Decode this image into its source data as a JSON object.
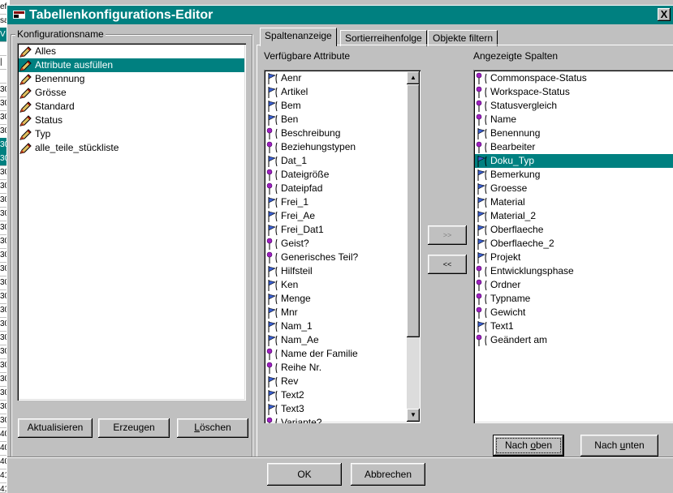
{
  "background_column": {
    "cells": [
      {
        "text": "ef",
        "hl": false
      },
      {
        "text": "sa",
        "hl": false
      },
      {
        "text": "V",
        "hl": true
      },
      {
        "text": "",
        "hl": false
      },
      {
        "text": "|",
        "hl": false
      },
      {
        "text": "",
        "hl": false
      },
      {
        "text": "30",
        "hl": false
      },
      {
        "text": "30",
        "hl": false
      },
      {
        "text": "30",
        "hl": false
      },
      {
        "text": "30",
        "hl": false
      },
      {
        "text": "30",
        "hl": true
      },
      {
        "text": "30",
        "hl": true
      },
      {
        "text": "30",
        "hl": false
      },
      {
        "text": "30",
        "hl": false
      },
      {
        "text": "30",
        "hl": false
      },
      {
        "text": "30",
        "hl": false
      },
      {
        "text": "30",
        "hl": false
      },
      {
        "text": "30",
        "hl": false
      },
      {
        "text": "30",
        "hl": false
      },
      {
        "text": "30",
        "hl": false
      },
      {
        "text": "30",
        "hl": false
      },
      {
        "text": "30",
        "hl": false
      },
      {
        "text": "30",
        "hl": false
      },
      {
        "text": "30",
        "hl": false
      },
      {
        "text": "30",
        "hl": false
      },
      {
        "text": "30",
        "hl": false
      },
      {
        "text": "30",
        "hl": false
      },
      {
        "text": "30",
        "hl": false
      },
      {
        "text": "30",
        "hl": false
      },
      {
        "text": "30",
        "hl": false
      },
      {
        "text": "30",
        "hl": false
      },
      {
        "text": "40",
        "hl": false
      },
      {
        "text": "40",
        "hl": false
      },
      {
        "text": "40",
        "hl": false
      },
      {
        "text": "41",
        "hl": false
      },
      {
        "text": "41",
        "hl": false
      }
    ]
  },
  "window": {
    "title": "Tabellenkonfigurations-Editor",
    "close_glyph": "X"
  },
  "config_group": {
    "legend": "Konfigurationsname",
    "items": [
      {
        "label": "Alles",
        "selected": false
      },
      {
        "label": "Attribute ausfüllen",
        "selected": true
      },
      {
        "label": "Benennung",
        "selected": false
      },
      {
        "label": "Grösse",
        "selected": false
      },
      {
        "label": "Standard",
        "selected": false
      },
      {
        "label": "Status",
        "selected": false
      },
      {
        "label": "Typ",
        "selected": false
      },
      {
        "label": "alle_teile_stückliste",
        "selected": false
      }
    ],
    "buttons": {
      "refresh": "Aktualisieren",
      "create": "Erzeugen",
      "delete_underlined": "L",
      "delete_rest": "öschen"
    }
  },
  "tabs": [
    {
      "label": "Spaltenanzeige",
      "active": true
    },
    {
      "label": "Sortierreihenfolge",
      "active": false
    },
    {
      "label": "Objekte filtern",
      "active": false
    }
  ],
  "available": {
    "label": "Verfügbare Attribute",
    "items": [
      {
        "label": "Aenr",
        "icon": "flag"
      },
      {
        "label": "Artikel",
        "icon": "flag"
      },
      {
        "label": "Bem",
        "icon": "flag"
      },
      {
        "label": "Ben",
        "icon": "flag"
      },
      {
        "label": "Beschreibung",
        "icon": "pin"
      },
      {
        "label": "Beziehungstypen",
        "icon": "pin"
      },
      {
        "label": "Dat_1",
        "icon": "flag"
      },
      {
        "label": "Dateigröße",
        "icon": "pin"
      },
      {
        "label": "Dateipfad",
        "icon": "pin"
      },
      {
        "label": "Frei_1",
        "icon": "flag"
      },
      {
        "label": "Frei_Ae",
        "icon": "flag"
      },
      {
        "label": "Frei_Dat1",
        "icon": "flag"
      },
      {
        "label": "Geist?",
        "icon": "pin"
      },
      {
        "label": "Generisches Teil?",
        "icon": "pin"
      },
      {
        "label": "Hilfsteil",
        "icon": "flag"
      },
      {
        "label": "Ken",
        "icon": "flag"
      },
      {
        "label": "Menge",
        "icon": "flag"
      },
      {
        "label": "Mnr",
        "icon": "flag"
      },
      {
        "label": "Nam_1",
        "icon": "flag"
      },
      {
        "label": "Nam_Ae",
        "icon": "flag"
      },
      {
        "label": "Name der Familie",
        "icon": "pin"
      },
      {
        "label": "Reihe Nr.",
        "icon": "pin"
      },
      {
        "label": "Rev",
        "icon": "flag"
      },
      {
        "label": "Text2",
        "icon": "flag"
      },
      {
        "label": "Text3",
        "icon": "flag"
      },
      {
        "label": "Variante?",
        "icon": "pin"
      }
    ]
  },
  "move_buttons": {
    "add": ">>",
    "remove": "<<"
  },
  "displayed": {
    "label": "Angezeigte Spalten",
    "items": [
      {
        "label": "Commonspace-Status",
        "icon": "pin",
        "selected": false
      },
      {
        "label": "Workspace-Status",
        "icon": "pin",
        "selected": false
      },
      {
        "label": "Statusvergleich",
        "icon": "pin",
        "selected": false
      },
      {
        "label": "Name",
        "icon": "pin",
        "selected": false
      },
      {
        "label": "Benennung",
        "icon": "flag",
        "selected": false
      },
      {
        "label": "Bearbeiter",
        "icon": "pin",
        "selected": false
      },
      {
        "label": "Doku_Typ",
        "icon": "flag",
        "selected": true
      },
      {
        "label": "Bemerkung",
        "icon": "flag",
        "selected": false
      },
      {
        "label": "Groesse",
        "icon": "flag",
        "selected": false
      },
      {
        "label": "Material",
        "icon": "flag",
        "selected": false
      },
      {
        "label": "Material_2",
        "icon": "flag",
        "selected": false
      },
      {
        "label": "Oberflaeche",
        "icon": "flag",
        "selected": false
      },
      {
        "label": "Oberflaeche_2",
        "icon": "flag",
        "selected": false
      },
      {
        "label": "Projekt",
        "icon": "flag",
        "selected": false
      },
      {
        "label": "Entwicklungsphase",
        "icon": "pin",
        "selected": false
      },
      {
        "label": "Ordner",
        "icon": "pin",
        "selected": false
      },
      {
        "label": "Typname",
        "icon": "pin",
        "selected": false
      },
      {
        "label": "Gewicht",
        "icon": "pin",
        "selected": false
      },
      {
        "label": "Text1",
        "icon": "flag",
        "selected": false
      },
      {
        "label": "Geändert am",
        "icon": "pin",
        "selected": false
      }
    ]
  },
  "order_buttons": {
    "up_pre": "Nach ",
    "up_ul": "o",
    "up_post": "ben",
    "down_pre": "Nach ",
    "down_ul": "u",
    "down_post": "nten"
  },
  "dialog_buttons": {
    "ok": "OK",
    "cancel": "Abbrechen"
  },
  "colors": {
    "selection": "#008080",
    "face": "#c0c0c0",
    "flag_icon": "#3a5fd0",
    "pin_icon": "#a020c0"
  }
}
